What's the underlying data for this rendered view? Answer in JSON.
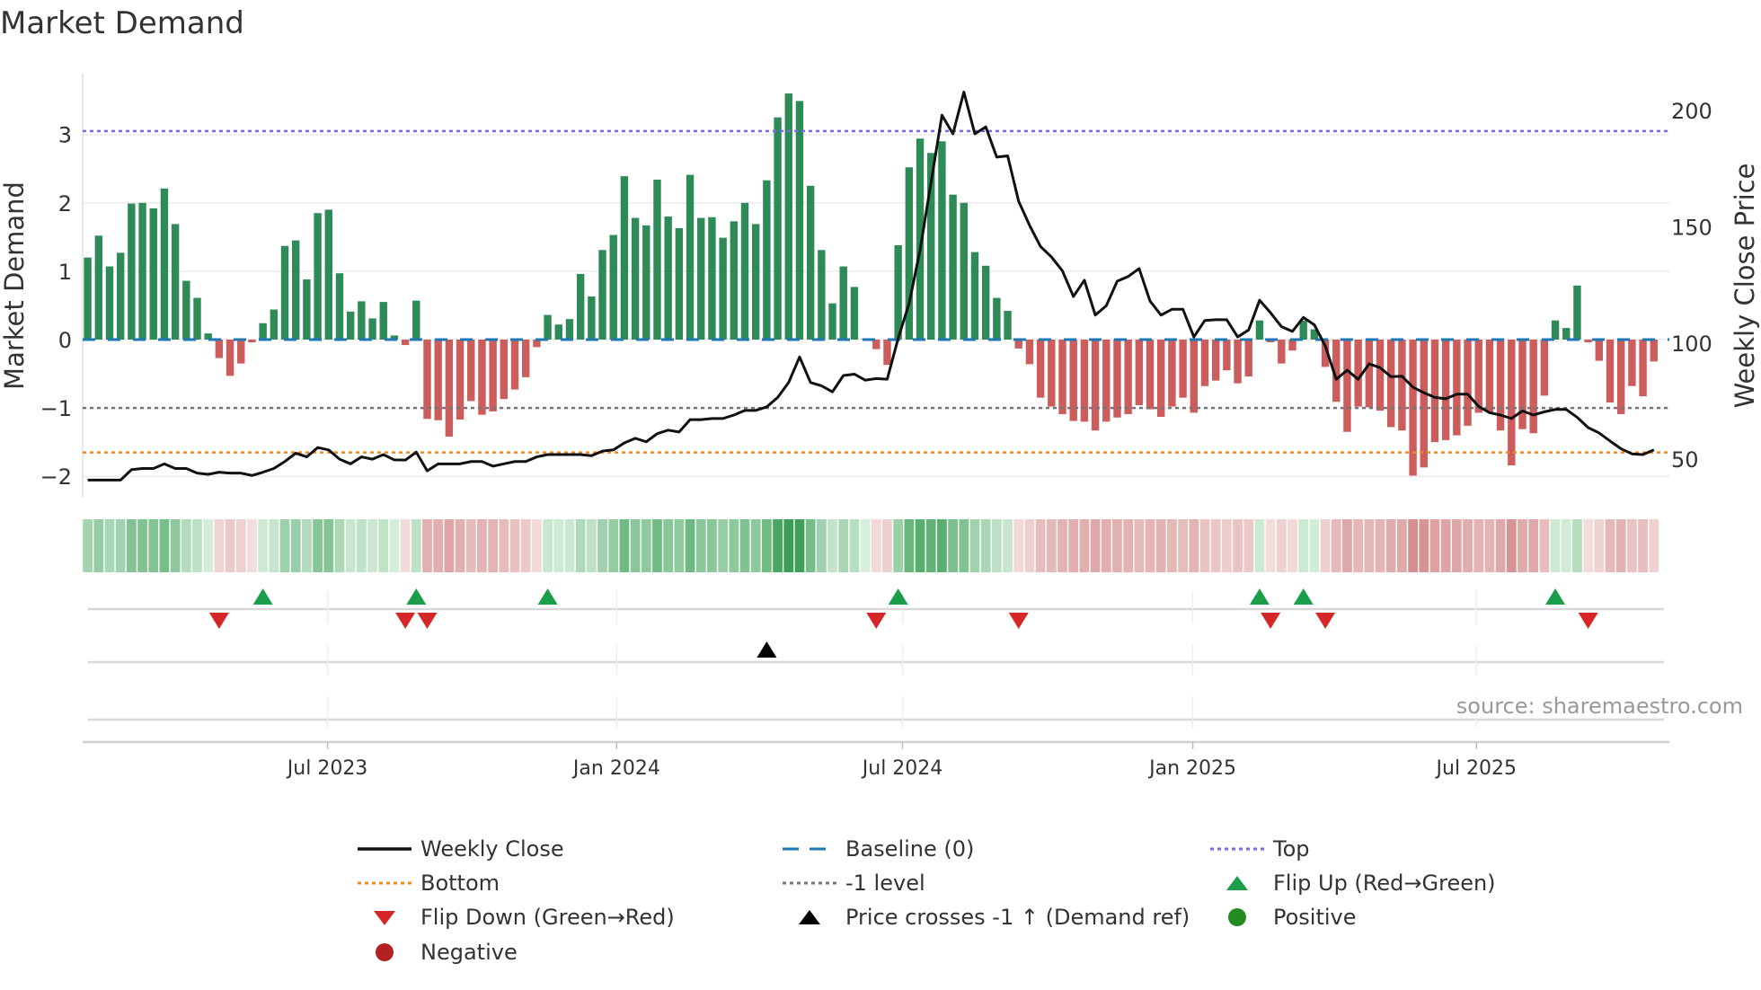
{
  "title": "Market Demand",
  "source": "source: sharemaestro.com",
  "colors": {
    "positive_bar": "#2e8b57",
    "negative_bar": "#cd5c5c",
    "price_line": "#111111",
    "baseline": "#1f77b4",
    "top": "#7b68ee",
    "bottom": "#f08a24",
    "minus_one": "#777777",
    "flip_up": "#1a9e4a",
    "flip_down": "#d62728",
    "price_cross": "#000000",
    "positive_dot": "#228b22",
    "negative_dot": "#b22222"
  },
  "legend": [
    {
      "label": "Weekly Close",
      "icon": "solid-line"
    },
    {
      "label": "Baseline (0)",
      "icon": "dashed-line"
    },
    {
      "label": "Top",
      "icon": "dotted-line"
    },
    {
      "label": "Bottom",
      "icon": "dotted-line"
    },
    {
      "label": "-1 level",
      "icon": "dotted-line"
    },
    {
      "label": "Flip Up (Red→Green)",
      "icon": "triangle-up"
    },
    {
      "label": "Flip Down (Green→Red)",
      "icon": "triangle-down"
    },
    {
      "label": "Price crosses -1 ↑ (Demand ref)",
      "icon": "triangle-up"
    },
    {
      "label": "Positive",
      "icon": "circle"
    },
    {
      "label": "Negative",
      "icon": "circle"
    }
  ],
  "chart_data": {
    "type": "bar",
    "title": "Market Demand",
    "ylabel": "Market Demand",
    "y2label": "Weekly Close Price",
    "ylim": [
      -2.3,
      3.9
    ],
    "yticks": [
      -2,
      -1,
      0,
      1,
      2,
      3
    ],
    "ytick_labels": [
      "−2",
      "−1",
      "0",
      "1",
      "2",
      "3"
    ],
    "y2ticks": [
      50,
      100,
      150,
      200
    ],
    "y2tick_labels": [
      "50",
      "100",
      "150",
      "200"
    ],
    "x_unit": "week index",
    "xticks": [
      {
        "pos": 21.9,
        "label": "Jul 2023"
      },
      {
        "pos": 48.3,
        "label": "Jan 2024"
      },
      {
        "pos": 74.4,
        "label": "Jul 2024"
      },
      {
        "pos": 100.9,
        "label": "Jan 2025"
      },
      {
        "pos": 126.8,
        "label": "Jul 2025"
      }
    ],
    "levels": {
      "top": 3.05,
      "baseline": 0,
      "minus_one": -1,
      "bottom": -1.65
    },
    "demand": [
      1.2,
      1.52,
      1.07,
      1.27,
      1.99,
      2.0,
      1.92,
      2.21,
      1.69,
      0.86,
      0.61,
      0.09,
      -0.27,
      -0.53,
      -0.35,
      -0.04,
      0.24,
      0.44,
      1.37,
      1.45,
      0.88,
      1.85,
      1.9,
      0.97,
      0.41,
      0.56,
      0.31,
      0.55,
      0.06,
      -0.08,
      0.57,
      -1.16,
      -1.18,
      -1.42,
      -1.17,
      -0.9,
      -1.1,
      -1.05,
      -0.87,
      -0.73,
      -0.55,
      -0.11,
      0.36,
      0.22,
      0.3,
      0.96,
      0.63,
      1.31,
      1.53,
      2.39,
      1.78,
      1.67,
      2.34,
      1.8,
      1.63,
      2.41,
      1.78,
      1.79,
      1.49,
      1.73,
      2.0,
      1.69,
      2.33,
      3.25,
      3.6,
      3.49,
      2.25,
      1.31,
      0.53,
      1.07,
      0.77,
      0.01,
      -0.14,
      -0.37,
      1.38,
      2.52,
      2.94,
      2.73,
      2.9,
      2.12,
      2.0,
      1.28,
      1.08,
      0.61,
      0.42,
      -0.13,
      -0.36,
      -0.85,
      -0.98,
      -1.09,
      -1.19,
      -1.2,
      -1.33,
      -1.2,
      -1.14,
      -1.09,
      -0.96,
      -1.02,
      -1.13,
      -0.98,
      -0.85,
      -1.07,
      -0.68,
      -0.6,
      -0.45,
      -0.64,
      -0.54,
      0.28,
      -0.04,
      -0.35,
      -0.16,
      0.28,
      0.15,
      -0.4,
      -0.91,
      -1.35,
      -0.98,
      -0.99,
      -1.04,
      -1.28,
      -1.33,
      -1.99,
      -1.87,
      -1.5,
      -1.47,
      -1.4,
      -1.26,
      -1.07,
      -1.06,
      -1.33,
      -1.84,
      -1.31,
      -1.37,
      -0.82,
      0.28,
      0.17,
      0.79,
      -0.04,
      -0.31,
      -0.92,
      -1.09,
      -0.68,
      -0.83,
      -0.32
    ],
    "weekly_close": [
      41,
      41,
      41,
      41,
      45.5,
      46,
      46,
      48,
      46,
      46,
      44,
      43.5,
      44.4,
      44,
      44,
      43,
      44.4,
      46,
      49,
      52.6,
      51,
      55,
      54,
      50,
      48,
      51,
      50,
      52,
      49.7,
      49.6,
      53,
      45,
      48,
      48,
      48,
      49,
      49,
      47,
      48,
      49,
      49,
      51,
      52,
      52,
      52,
      52,
      51.5,
      53.5,
      54,
      57,
      59,
      57.5,
      61,
      62.5,
      61.7,
      67,
      67,
      67.5,
      67.5,
      69,
      71,
      71,
      72.5,
      76.6,
      83,
      94,
      83,
      81.6,
      79,
      86,
      86.6,
      84,
      84.7,
      84.4,
      102,
      117,
      140,
      169,
      198,
      190,
      208,
      190,
      193,
      180,
      180.5,
      161,
      150.6,
      141.5,
      137,
      131,
      120,
      127,
      112,
      116,
      126.6,
      128.6,
      132,
      118,
      112,
      114.5,
      114.5,
      102.6,
      109.7,
      110,
      110,
      102.6,
      105.6,
      118.4,
      113,
      107,
      105,
      111,
      107.8,
      98.7,
      84.4,
      88.3,
      84.4,
      91,
      89.4,
      85.5,
      85.7,
      81,
      78.6,
      76.6,
      76,
      78,
      78,
      72.7,
      70,
      69,
      67.5,
      70.8,
      69,
      70.4,
      71.4,
      71.4,
      68,
      63.6,
      61.3,
      57.8,
      54.5,
      52.3,
      52,
      54
    ],
    "flip_up": [
      16,
      30,
      42,
      74,
      107,
      111,
      134
    ],
    "flip_down": [
      12,
      29,
      31,
      72,
      85,
      108,
      113,
      137
    ],
    "price_cross_up": [
      62
    ]
  }
}
